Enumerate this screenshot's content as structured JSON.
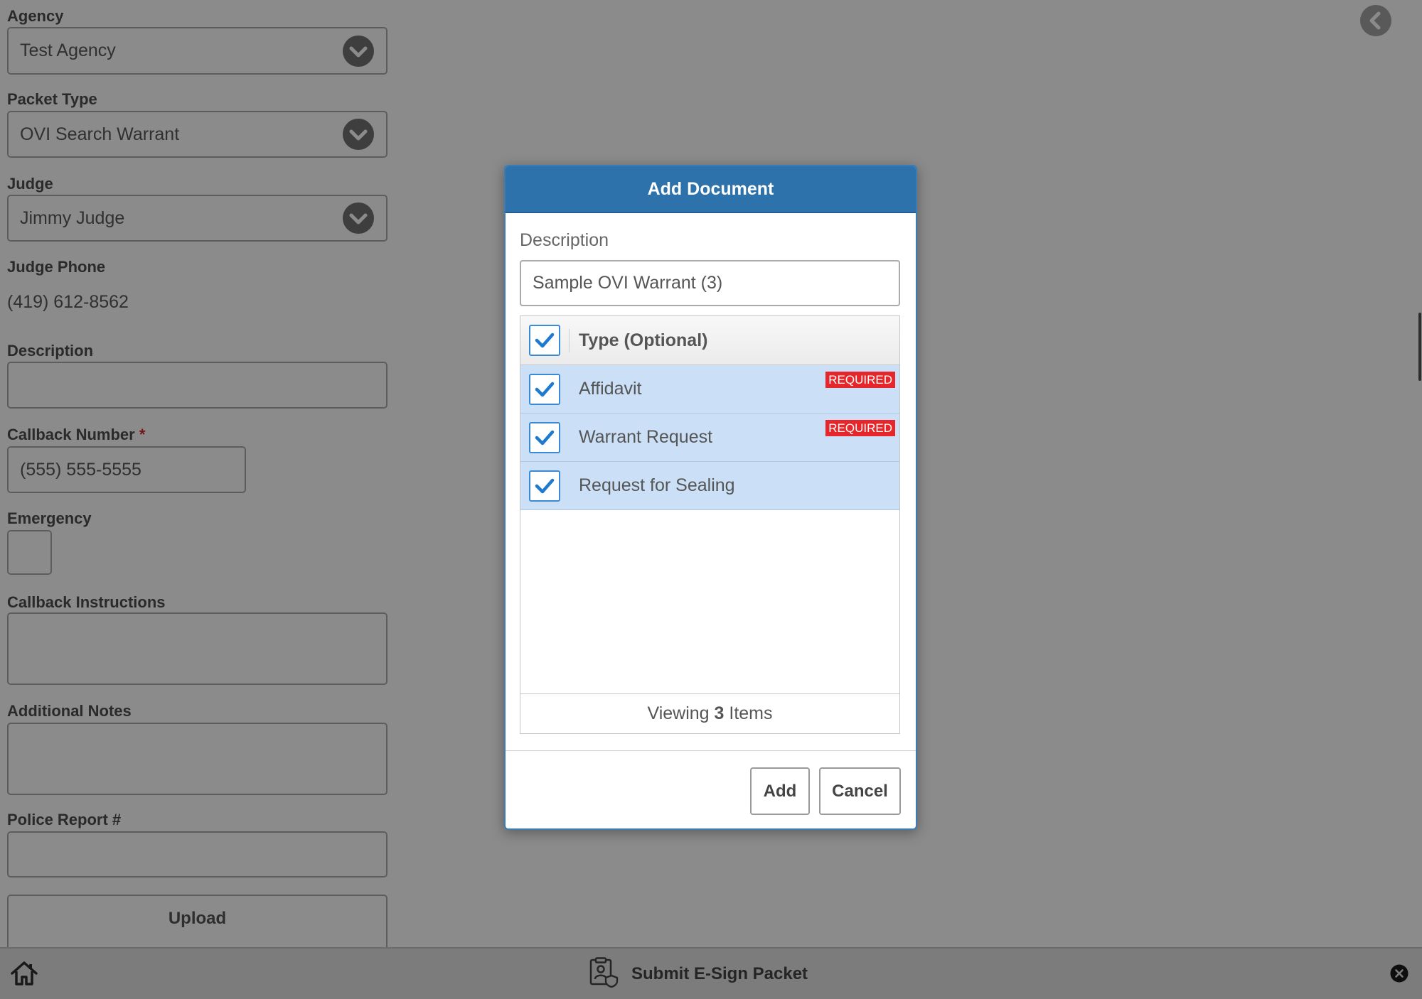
{
  "form": {
    "agency": {
      "label": "Agency",
      "value": "Test Agency"
    },
    "packet_type": {
      "label": "Packet Type",
      "value": "OVI Search Warrant"
    },
    "judge": {
      "label": "Judge",
      "value": "Jimmy Judge"
    },
    "judge_phone": {
      "label": "Judge Phone",
      "value": "(419) 612-8562"
    },
    "description": {
      "label": "Description",
      "value": ""
    },
    "callback_number": {
      "label": "Callback Number",
      "required_mark": "*",
      "value": "(555) 555-5555"
    },
    "emergency": {
      "label": "Emergency",
      "checked": false
    },
    "callback_instructions": {
      "label": "Callback Instructions",
      "value": ""
    },
    "additional_notes": {
      "label": "Additional Notes",
      "value": ""
    },
    "police_report": {
      "label": "Police Report #",
      "value": ""
    },
    "upload_button": "Upload"
  },
  "header": {
    "back_icon": "chevron-left-icon"
  },
  "modal": {
    "title": "Add Document",
    "description": {
      "label": "Description",
      "value": "Sample OVI Warrant (3)"
    },
    "grid": {
      "header": {
        "label": "Type (Optional)",
        "checked": true
      },
      "rows": [
        {
          "label": "Affidavit",
          "checked": true,
          "badge": "REQUIRED"
        },
        {
          "label": "Warrant Request",
          "checked": true,
          "badge": "REQUIRED"
        },
        {
          "label": "Request for Sealing",
          "checked": true
        }
      ],
      "footer": {
        "prefix": "Viewing",
        "count": "3",
        "suffix": "Items"
      }
    },
    "buttons": {
      "add": "Add",
      "cancel": "Cancel"
    }
  },
  "bottom_bar": {
    "title": "Submit E-Sign Packet",
    "home_icon": "home-icon",
    "packet_icon": "esign-packet-icon",
    "close_icon": "close-circle-icon"
  },
  "icons": {
    "select_arrow": "chevron-down-icon",
    "checkbox_check": "checkmark-icon"
  },
  "colors": {
    "modal_header": "#2e72ab",
    "selected_row": "#cbe0f6",
    "required_badge": "#e5262b",
    "checkbox_blue": "#1e7ad0",
    "required_star": "#d42a2a",
    "overlay": "rgba(0,0,0,0.455)"
  }
}
